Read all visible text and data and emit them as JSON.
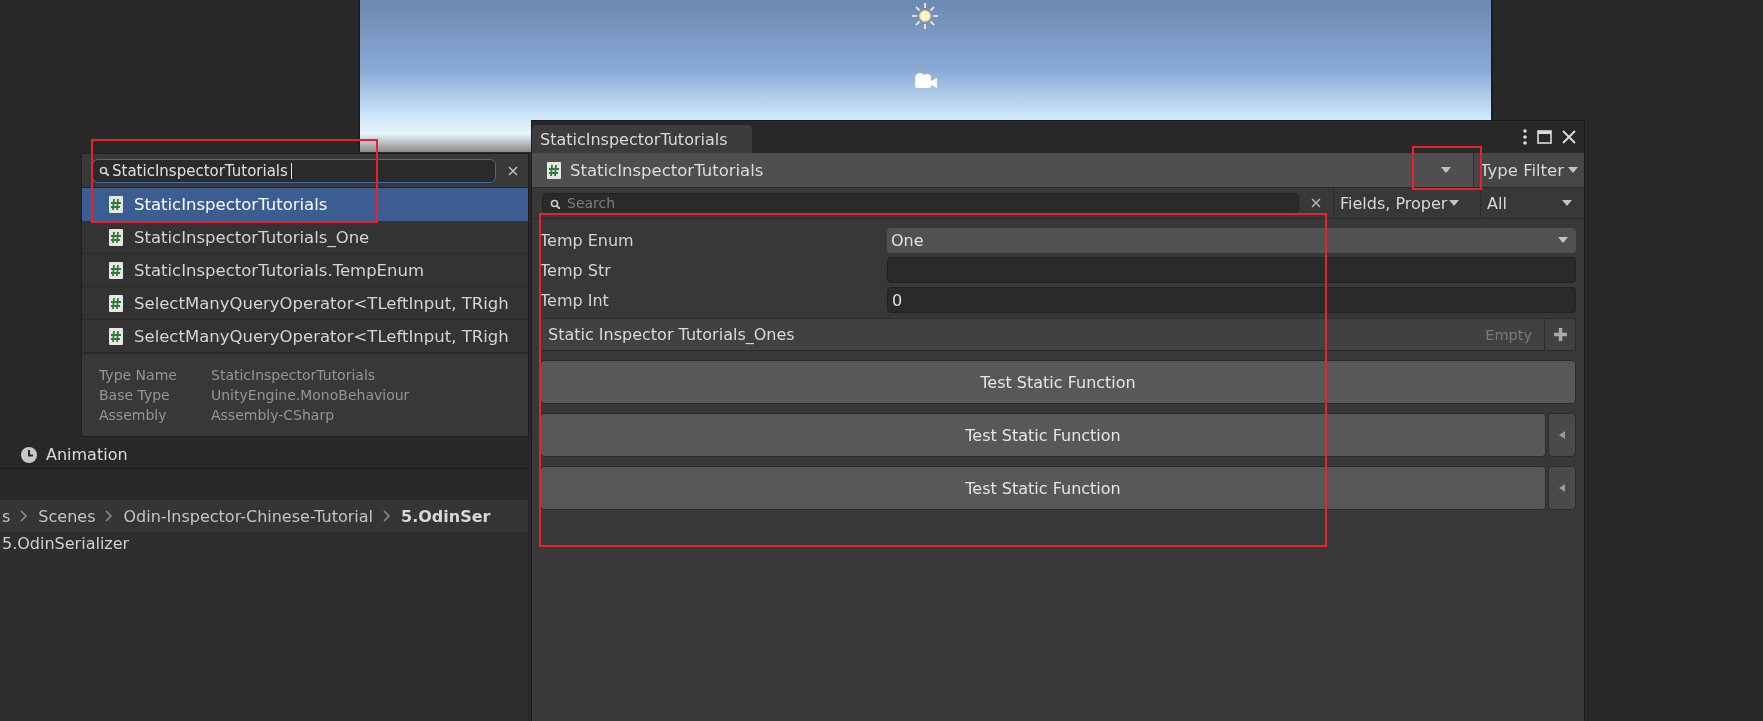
{
  "animation_panel": {
    "tab_label": "Animation"
  },
  "breadcrumb": {
    "items": [
      {
        "label": "s",
        "current": false
      },
      {
        "label": "Scenes",
        "current": false
      },
      {
        "label": "Odin-Inspector-Chinese-Tutorial",
        "current": false
      },
      {
        "label": "5.OdinSer",
        "current": true
      }
    ]
  },
  "hierarchy": {
    "items": [
      "5.OdinSerializer"
    ]
  },
  "type_picker": {
    "search": {
      "value": "StaticInspectorTutorials"
    },
    "results": [
      {
        "label": "StaticInspectorTutorials",
        "selected": true
      },
      {
        "label": "StaticInspectorTutorials_One",
        "selected": false
      },
      {
        "label": "StaticInspectorTutorials.TempEnum",
        "selected": false
      },
      {
        "label": "SelectManyQueryOperator<TLeftInput, TRigh",
        "selected": false
      },
      {
        "label": "SelectManyQueryOperator<TLeftInput, TRigh",
        "selected": false
      }
    ],
    "info": [
      {
        "key": "Type Name",
        "value": "StaticInspectorTutorials"
      },
      {
        "key": "Base Type",
        "value": "UnityEngine.MonoBehaviour"
      },
      {
        "key": "Assembly",
        "value": "Assembly-CSharp"
      }
    ]
  },
  "inspector": {
    "tab": {
      "label": "StaticInspectorTutorials"
    },
    "type_field": {
      "value": "StaticInspectorTutorials"
    },
    "type_filter": {
      "label": "Type Filter"
    },
    "search": {
      "placeholder": "Search"
    },
    "member_filter": {
      "value": "Fields,  Proper"
    },
    "access_filter": {
      "value": "All"
    },
    "properties": [
      {
        "label": "Temp Enum",
        "kind": "dropdown",
        "value": "One"
      },
      {
        "label": "Temp Str",
        "kind": "text"
      },
      {
        "label": "Temp Int",
        "kind": "text",
        "value": "0"
      }
    ],
    "list": {
      "title": "Static Inspector Tutorials_Ones",
      "status": "Empty"
    },
    "buttons": [
      {
        "label": "Test Static Function",
        "expandable": false
      },
      {
        "label": "Test Static Function",
        "expandable": true
      },
      {
        "label": "Test Static Function",
        "expandable": true
      }
    ]
  }
}
